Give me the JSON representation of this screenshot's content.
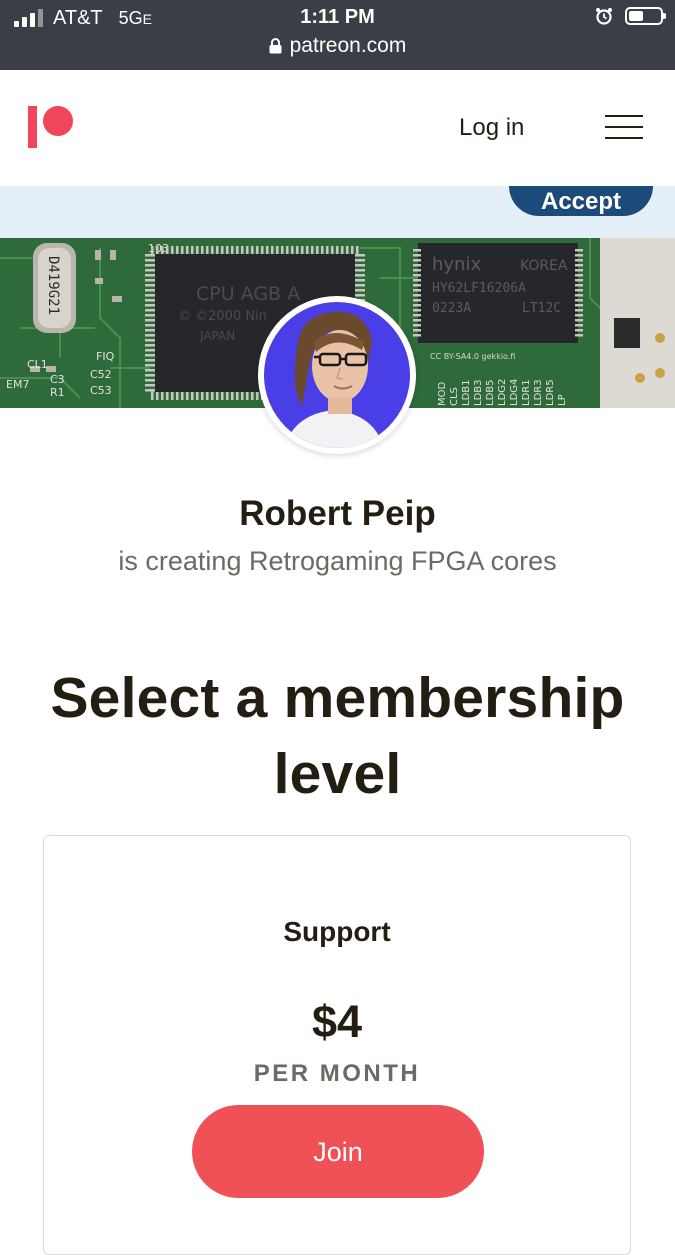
{
  "status_bar": {
    "carrier": "AT&T",
    "network": "5G",
    "network_suffix": "E",
    "time": "1:11 PM",
    "url": "patreon.com",
    "icons": [
      "signal-icon",
      "lock-icon",
      "alarm-icon",
      "battery-icon"
    ]
  },
  "header": {
    "logo": "patreon-logo",
    "login_label": "Log in",
    "menu_icon": "hamburger-menu-icon"
  },
  "cookie_banner": {
    "accept_label": "Accept"
  },
  "cover": {
    "watermark": "CC BY-SA4.0 gekkio.fi"
  },
  "creator": {
    "name": "Robert Peip",
    "tagline": "is creating Retrogaming FPGA cores"
  },
  "page": {
    "heading_line1": "Select a membership",
    "heading_line2": "level"
  },
  "tier": {
    "name": "Support",
    "price": "$4",
    "period": "PER MONTH",
    "join_label": "Join"
  },
  "colors": {
    "brand": "#f1465a",
    "join_button": "#ef5156",
    "accept_button": "#1c4b79",
    "status_bar": "#3a3f45",
    "cookie_bg": "#e5eff8",
    "text_primary": "#241e12",
    "text_secondary": "#6e6a63"
  }
}
